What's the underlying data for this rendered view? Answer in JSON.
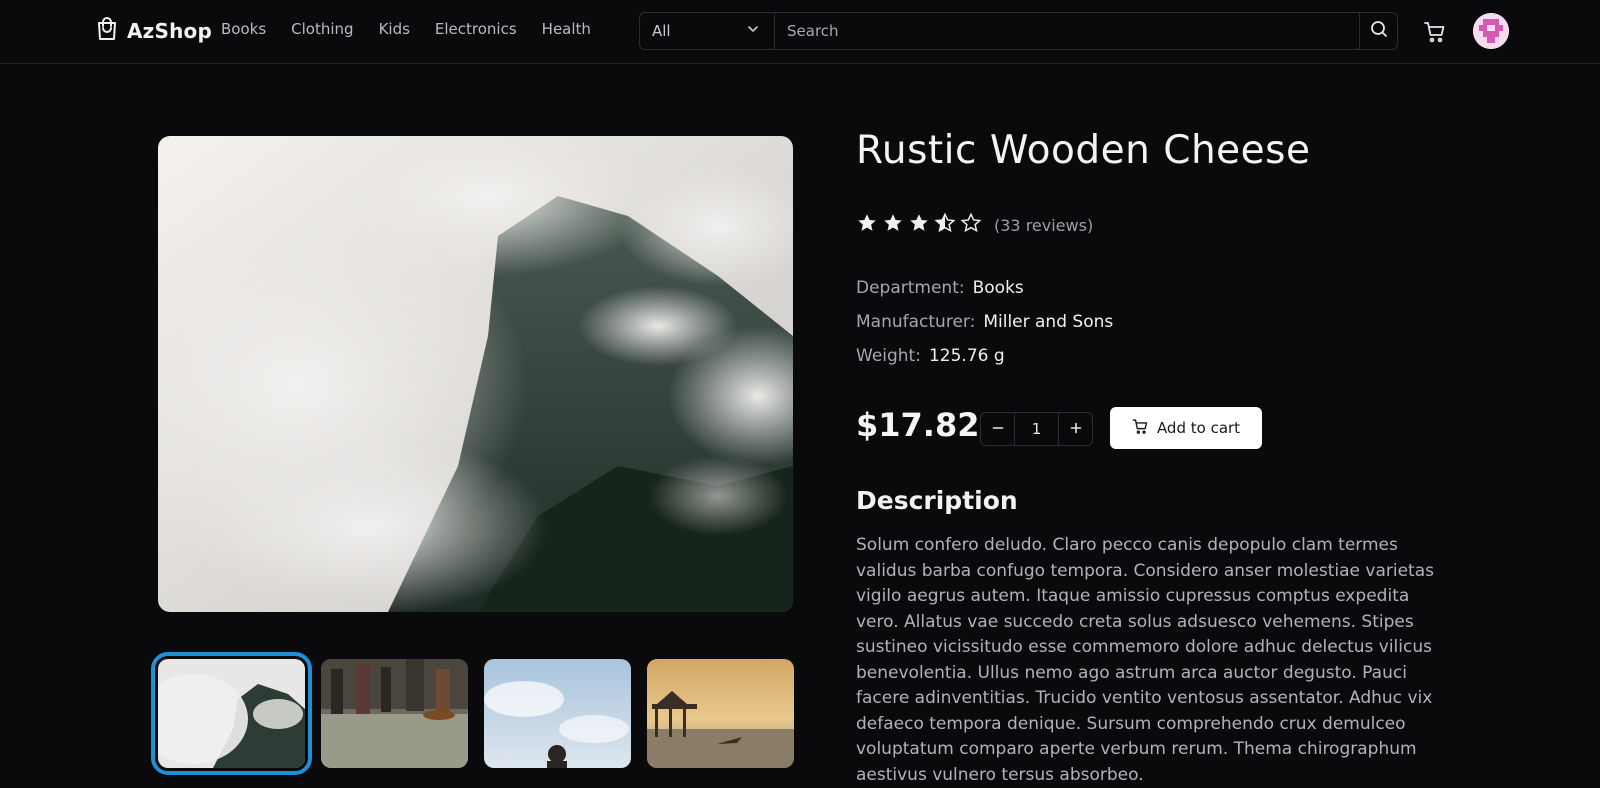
{
  "header": {
    "brand": "AzShop",
    "nav": [
      "Books",
      "Clothing",
      "Kids",
      "Electronics",
      "Health"
    ],
    "search": {
      "category": "All",
      "placeholder": "Search"
    }
  },
  "product": {
    "title": "Rustic Wooden Cheese",
    "rating": 3.5,
    "rating_max": 5,
    "reviews": "(33 reviews)",
    "attributes": [
      {
        "key": "Department:",
        "value": "Books"
      },
      {
        "key": "Manufacturer:",
        "value": "Miller and Sons"
      },
      {
        "key": "Weight:",
        "value": "125.76 g"
      }
    ],
    "price": "$17.82",
    "quantity": "1",
    "add_to_cart": "Add to cart",
    "description_title": "Description",
    "description": "Solum confero deludo. Claro pecco canis depopulo clam termes validus barba confugo tempora. Considero anser molestiae varietas vigilo aegrus autem. Itaque amissio cupressus comptus expedita vero. Allatus vae succedo creta solus adsuesco vehemens. Stipes sustineo vicissitudo esse commemoro dolore adhuc delectus vilicus benevolentia. Ullus nemo ago astrum arca auctor degusto. Pauci facere adinventitias. Trucido ventito ventosus assentator. Adhuc vix defaeco tempora denique. Sursum comprehendo crux demulceo voluptatum comparo aperte verbum rerum. Thema chirographum aestivus vulnero tersus absorbeo."
  },
  "gallery": {
    "selected_index": 0,
    "thumbnails": [
      "misty-mountain",
      "train-commuters",
      "sky-person",
      "sunset-pier"
    ]
  },
  "colors": {
    "background": "#0a0a0d",
    "accent": "#1e90d6",
    "primary_button": "#ffffff"
  }
}
